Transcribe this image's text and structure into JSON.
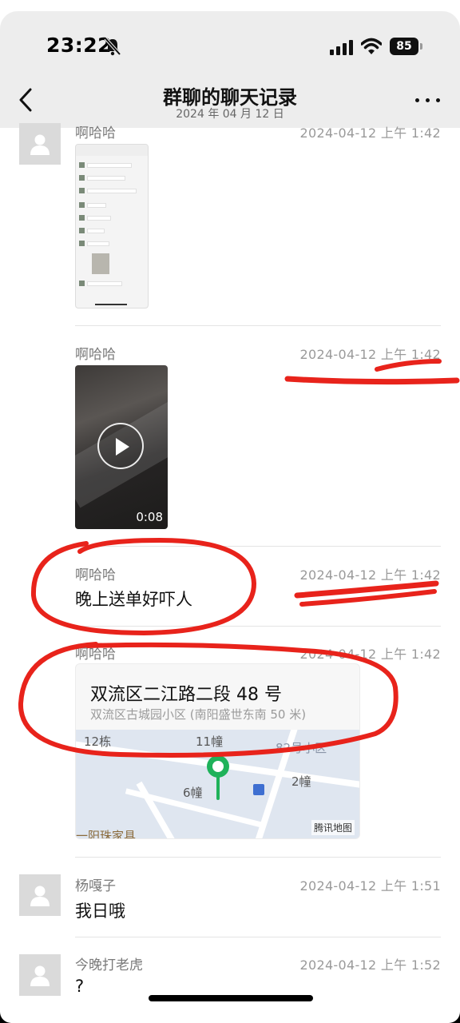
{
  "status_bar": {
    "time": "23:22",
    "battery": "85"
  },
  "nav": {
    "title": "群聊的聊天记录",
    "subtitle": "2024 年 04 月 12 日"
  },
  "messages": [
    {
      "sender": "啊哈哈",
      "time": "2024-04-12 上午 1:42",
      "type": "image"
    },
    {
      "sender": "啊哈哈",
      "time": "2024-04-12 上午 1:42",
      "type": "video",
      "duration": "0:08"
    },
    {
      "sender": "啊哈哈",
      "time": "2024-04-12 上午 1:42",
      "type": "text",
      "text": "晚上送单好吓人"
    },
    {
      "sender": "啊哈哈",
      "time": "2024-04-12 上午 1:42",
      "type": "location",
      "location": {
        "name": "双流区二江路二段 48 号",
        "address": "双流区古城园小区 (南阳盛世东南 50 米)",
        "map_labels": [
          "12栋",
          "11幢",
          "6幢",
          "2幢",
          "82号小区",
          "一阳珠家具"
        ],
        "map_brand": "腾讯地图"
      }
    },
    {
      "sender": "杨嘎子",
      "time": "2024-04-12 上午 1:51",
      "type": "text",
      "text": "我日哦"
    },
    {
      "sender": "今晚打老虎",
      "time": "2024-04-12 上午 1:52",
      "type": "text",
      "text": "?"
    }
  ],
  "colors": {
    "background": "#ffffff",
    "header": "#ededed",
    "annotation_red": "#e8231b",
    "map_pin": "#1fb25a"
  }
}
